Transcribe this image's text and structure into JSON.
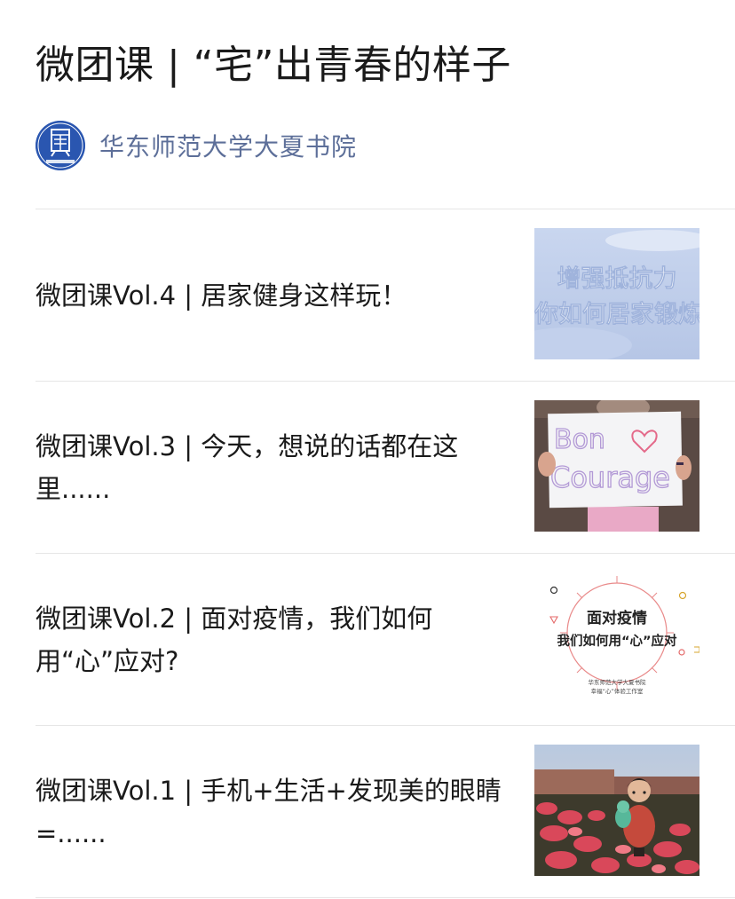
{
  "article": {
    "title": "微团课 | “宅”出青春的样子"
  },
  "account": {
    "name": "华东师范大学大夏书院",
    "avatar_icon": "college-logo-icon",
    "brand_color": "#2a56b0"
  },
  "items": [
    {
      "title": "微团课Vol.4 | 居家健身这样玩！",
      "thumb_lines": [
        "增强抵抗力",
        "你如何居家锻炼"
      ],
      "thumb_icon": "fitness-poster-thumbnail"
    },
    {
      "title": "微团课Vol.3 | 今天，想说的话都在这里......",
      "thumb_lines": [
        "Bon",
        "Courage"
      ],
      "thumb_icon": "bon-courage-sign-photo"
    },
    {
      "title": "微团课Vol.2 | 面对疫情，我们如何用“心”应对?",
      "thumb_lines": [
        "面对疫情",
        "我们如何用“心”应对",
        "华东师范大学大夏书院",
        "幸福“心”体验工作室"
      ],
      "thumb_icon": "heart-coping-poster"
    },
    {
      "title": "微团课Vol.1 | 手机+生活+发现美的眼睛=......",
      "thumb_icon": "flowers-figurine-photo"
    }
  ]
}
